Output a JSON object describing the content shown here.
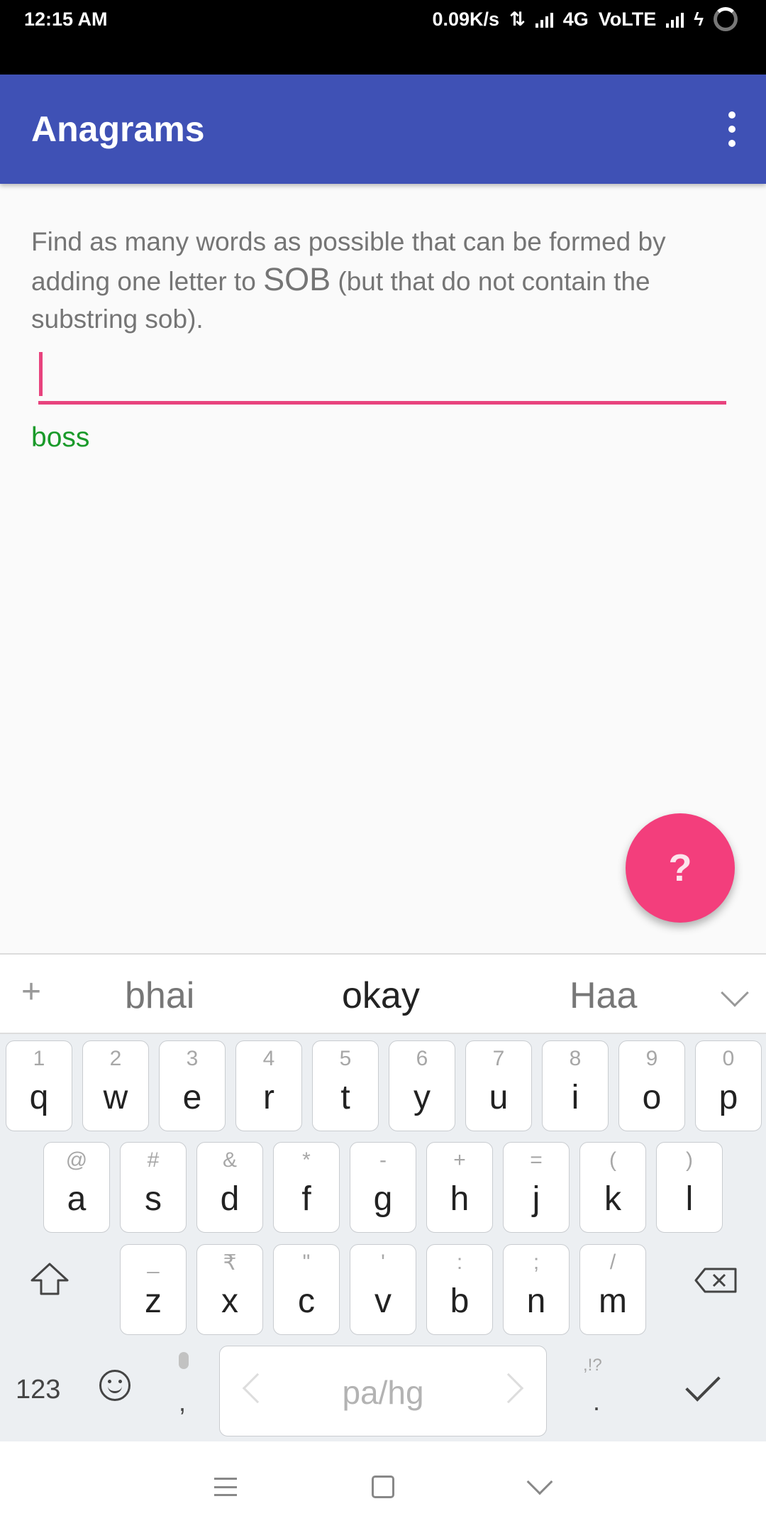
{
  "status_bar": {
    "time": "12:15 AM",
    "speed": "0.09K/s",
    "network": "4G",
    "volte": "VoLTE"
  },
  "app_bar": {
    "title": "Anagrams",
    "overflow_icon": "more-vert-icon"
  },
  "content": {
    "instruction_prefix": "Find as many words as possible that can be formed by adding one letter to ",
    "starter_word": "SOB",
    "instruction_suffix": " (but that do not contain the substring sob).",
    "input_value": "",
    "found_words": [
      "boss"
    ],
    "fab_label": "?"
  },
  "keyboard": {
    "suggestions": [
      "bhai",
      "okay",
      "Haa"
    ],
    "plus": "+",
    "row1": [
      {
        "hint": "1",
        "key": "q"
      },
      {
        "hint": "2",
        "key": "w"
      },
      {
        "hint": "3",
        "key": "e"
      },
      {
        "hint": "4",
        "key": "r"
      },
      {
        "hint": "5",
        "key": "t"
      },
      {
        "hint": "6",
        "key": "y"
      },
      {
        "hint": "7",
        "key": "u"
      },
      {
        "hint": "8",
        "key": "i"
      },
      {
        "hint": "9",
        "key": "o"
      },
      {
        "hint": "0",
        "key": "p"
      }
    ],
    "row2": [
      {
        "hint": "@",
        "key": "a"
      },
      {
        "hint": "#",
        "key": "s"
      },
      {
        "hint": "&",
        "key": "d"
      },
      {
        "hint": "*",
        "key": "f"
      },
      {
        "hint": "-",
        "key": "g"
      },
      {
        "hint": "+",
        "key": "h"
      },
      {
        "hint": "=",
        "key": "j"
      },
      {
        "hint": "(",
        "key": "k"
      },
      {
        "hint": ")",
        "key": "l"
      }
    ],
    "row3": [
      {
        "hint": "_",
        "key": "z"
      },
      {
        "hint": "₹",
        "key": "x"
      },
      {
        "hint": "\"",
        "key": "c"
      },
      {
        "hint": "'",
        "key": "v"
      },
      {
        "hint": ":",
        "key": "b"
      },
      {
        "hint": ";",
        "key": "n"
      },
      {
        "hint": "/",
        "key": "m"
      }
    ],
    "numeric_label": "123",
    "comma": ",",
    "space_label": "pa/hg",
    "period_hint": ",!?",
    "period": "."
  },
  "colors": {
    "app_bar": "#3f51b5",
    "accent": "#f33e7c",
    "found_word": "#1a9a2a"
  }
}
